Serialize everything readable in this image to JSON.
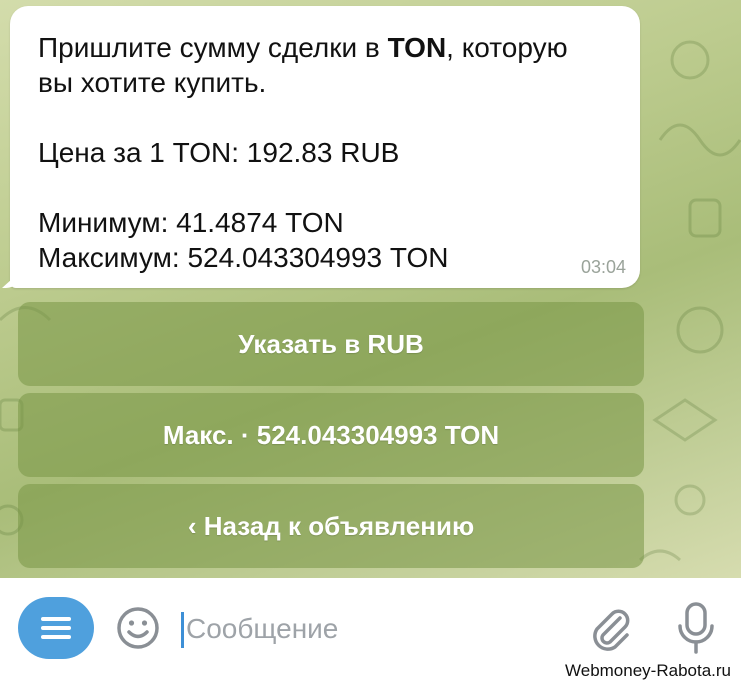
{
  "message": {
    "line1_prefix": "Пришлите сумму сделки в ",
    "line1_bold": "TON",
    "line1_suffix": ", которую",
    "line2": "вы хотите купить.",
    "price": "Цена за 1 TON: 192.83 RUB",
    "min": "Минимум: 41.4874 TON",
    "max": "Максимум: 524.043304993 TON",
    "time": "03:04"
  },
  "keyboard": {
    "buttons": [
      {
        "label": "Указать в RUB"
      },
      {
        "label": "Макс. · 524.043304993 TON"
      },
      {
        "label": "‹ Назад к объявлению"
      }
    ]
  },
  "input": {
    "placeholder": "Сообщение",
    "value": ""
  },
  "icons": {
    "menu": "menu-icon",
    "emoji": "emoji-icon",
    "attach": "paperclip-icon",
    "mic": "microphone-icon"
  },
  "colors": {
    "accent": "#4fa0dd",
    "button_bg": "#8fa95a"
  },
  "watermark": "Webmoney-Rabota.ru"
}
